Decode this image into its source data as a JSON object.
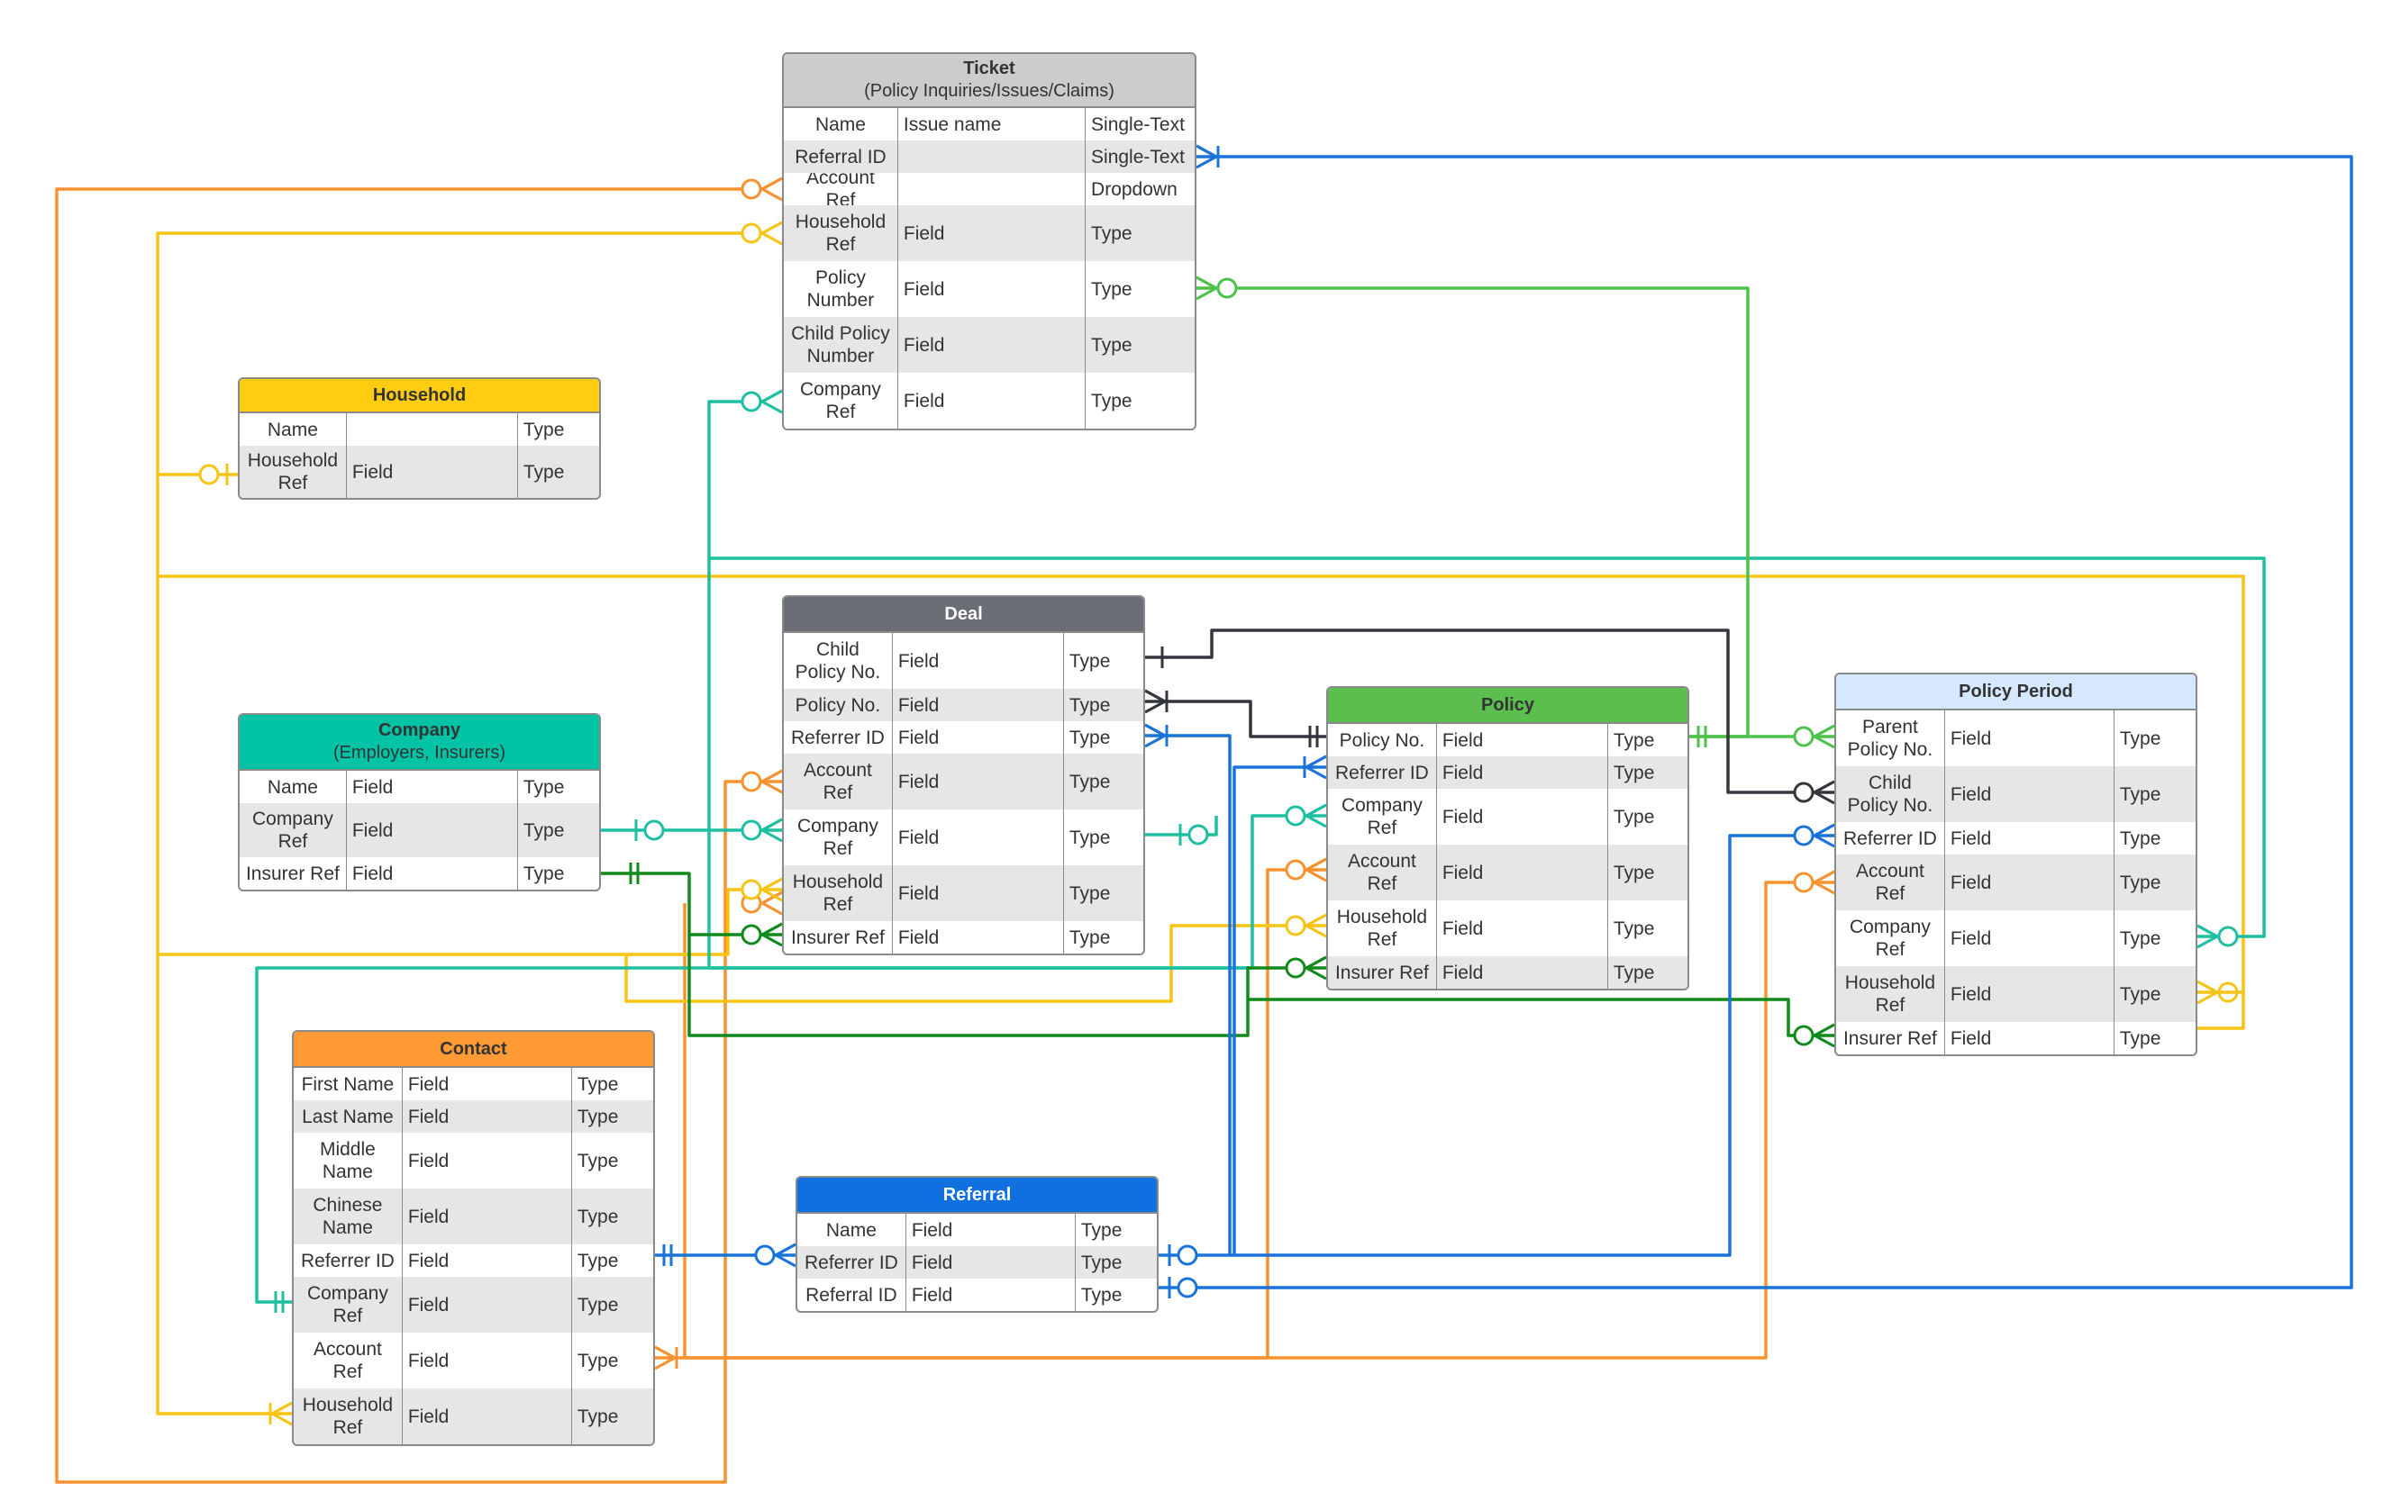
{
  "entities": {
    "ticket": {
      "title": "Ticket",
      "subtitle": "(Policy Inquiries/Issues/Claims)",
      "header_color": "#cccccc",
      "header_text_color": "#333333",
      "rows": [
        {
          "name": "Name",
          "field": "Issue name",
          "type": "Single-Text"
        },
        {
          "name": "Referral ID",
          "field": "",
          "type": "Single-Text"
        },
        {
          "name": "Account Ref",
          "field": "",
          "type": "Dropdown"
        },
        {
          "name": "Household Ref",
          "field": "Field",
          "type": "Type"
        },
        {
          "name": "Policy Number",
          "field": "Field",
          "type": "Type"
        },
        {
          "name": "Child Policy Number",
          "field": "Field",
          "type": "Type"
        },
        {
          "name": "Company Ref",
          "field": "Field",
          "type": "Type"
        }
      ]
    },
    "household": {
      "title": "Household",
      "subtitle": "",
      "header_color": "#ffcc10",
      "header_text_color": "#333333",
      "rows": [
        {
          "name": "Name",
          "field": "",
          "type": "Type"
        },
        {
          "name": "Household Ref",
          "field": "Field",
          "type": "Type"
        }
      ]
    },
    "company": {
      "title": "Company",
      "subtitle": "(Employers, Insurers)",
      "header_color": "#00c3a6",
      "header_text_color": "#333333",
      "rows": [
        {
          "name": "Name",
          "field": "Field",
          "type": "Type"
        },
        {
          "name": "Company Ref",
          "field": "Field",
          "type": "Type"
        },
        {
          "name": "Insurer Ref",
          "field": "Field",
          "type": "Type"
        }
      ]
    },
    "deal": {
      "title": "Deal",
      "subtitle": "",
      "header_color": "#6b6e75",
      "header_text_color": "#ffffff",
      "rows": [
        {
          "name": "Child Policy No.",
          "field": "Field",
          "type": "Type"
        },
        {
          "name": "Policy No.",
          "field": "Field",
          "type": "Type"
        },
        {
          "name": "Referrer ID",
          "field": "Field",
          "type": "Type"
        },
        {
          "name": "Account Ref",
          "field": "Field",
          "type": "Type"
        },
        {
          "name": "Company Ref",
          "field": "Field",
          "type": "Type"
        },
        {
          "name": "Household Ref",
          "field": "Field",
          "type": "Type"
        },
        {
          "name": "Insurer Ref",
          "field": "Field",
          "type": "Type"
        }
      ]
    },
    "policy": {
      "title": "Policy",
      "subtitle": "",
      "header_color": "#5bbe4e",
      "header_text_color": "#333333",
      "rows": [
        {
          "name": "Policy No.",
          "field": "Field",
          "type": "Type"
        },
        {
          "name": "Referrer ID",
          "field": "Field",
          "type": "Type"
        },
        {
          "name": "Company Ref",
          "field": "Field",
          "type": "Type"
        },
        {
          "name": "Account Ref",
          "field": "Field",
          "type": "Type"
        },
        {
          "name": "Household Ref",
          "field": "Field",
          "type": "Type"
        },
        {
          "name": "Insurer Ref",
          "field": "Field",
          "type": "Type"
        }
      ]
    },
    "policy_period": {
      "title": "Policy Period",
      "subtitle": "",
      "header_color": "#d6e8ff",
      "header_text_color": "#333333",
      "rows": [
        {
          "name": "Parent Policy No.",
          "field": "Field",
          "type": "Type"
        },
        {
          "name": "Child Policy No.",
          "field": "Field",
          "type": "Type"
        },
        {
          "name": "Referrer ID",
          "field": "Field",
          "type": "Type"
        },
        {
          "name": "Account Ref",
          "field": "Field",
          "type": "Type"
        },
        {
          "name": "Company Ref",
          "field": "Field",
          "type": "Type"
        },
        {
          "name": "Household Ref",
          "field": "Field",
          "type": "Type"
        },
        {
          "name": "Insurer Ref",
          "field": "Field",
          "type": "Type"
        }
      ]
    },
    "contact": {
      "title": "Contact",
      "subtitle": "",
      "header_color": "#ff9a35",
      "header_text_color": "#333333",
      "rows": [
        {
          "name": "First Name",
          "field": "Field",
          "type": "Type"
        },
        {
          "name": "Last Name",
          "field": "Field",
          "type": "Type"
        },
        {
          "name": "Middle Name",
          "field": "Field",
          "type": "Type"
        },
        {
          "name": "Chinese Name",
          "field": "Field",
          "type": "Type"
        },
        {
          "name": "Referrer ID",
          "field": "Field",
          "type": "Type"
        },
        {
          "name": "Company Ref",
          "field": "Field",
          "type": "Type"
        },
        {
          "name": "Account Ref",
          "field": "Field",
          "type": "Type"
        },
        {
          "name": "Household Ref",
          "field": "Field",
          "type": "Type"
        }
      ]
    },
    "referral": {
      "title": "Referral",
      "subtitle": "",
      "header_color": "#1170e0",
      "header_text_color": "#ffffff",
      "rows": [
        {
          "name": "Name",
          "field": "Field",
          "type": "Type"
        },
        {
          "name": "Referrer ID",
          "field": "Field",
          "type": "Type"
        },
        {
          "name": "Referral ID",
          "field": "Field",
          "type": "Type"
        }
      ]
    }
  },
  "line_colors": {
    "orange": "#f7922f",
    "yellow": "#f6c415",
    "teal": "#1dbfa0",
    "green": "#4cc24a",
    "dark_green": "#118a1c",
    "blue": "#1a73d9",
    "dark": "#33373d"
  }
}
